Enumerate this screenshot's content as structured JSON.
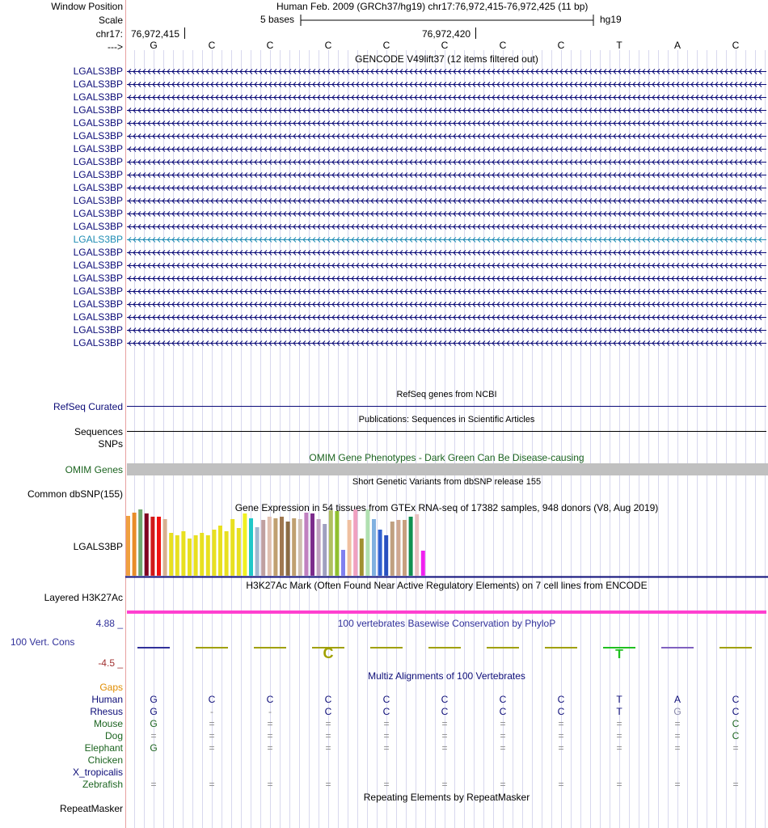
{
  "header": {
    "window_position_label": "Window Position",
    "window_position_value": "Human Feb. 2009 (GRCh37/hg19)   chr17:76,972,415-76,972,425 (11 bp)",
    "scale_label": "Scale",
    "scale_value": "5 bases",
    "assembly": "hg19",
    "chrom_label": "chr17:",
    "coord_left": "76,972,415",
    "coord_mid": "76,972,420",
    "strand_label": "--->"
  },
  "bases": [
    "G",
    "C",
    "C",
    "C",
    "C",
    "C",
    "C",
    "C",
    "T",
    "A",
    "C"
  ],
  "gencode": {
    "title": "GENCODE V49lift37 (12 items filtered out)",
    "items": [
      "LGALS3BP",
      "LGALS3BP",
      "LGALS3BP",
      "LGALS3BP",
      "LGALS3BP",
      "LGALS3BP",
      "LGALS3BP",
      "LGALS3BP",
      "LGALS3BP",
      "LGALS3BP",
      "LGALS3BP",
      "LGALS3BP",
      "LGALS3BP",
      "LGALS3BP",
      "LGALS3BP",
      "LGALS3BP",
      "LGALS3BP",
      "LGALS3BP",
      "LGALS3BP",
      "LGALS3BP",
      "LGALS3BP",
      "LGALS3BP"
    ],
    "highlight_index": 13,
    "color": "#0c0c78",
    "highlight_color": "#1e8cb4"
  },
  "refseq": {
    "title": "RefSeq genes from NCBI",
    "label": "RefSeq Curated"
  },
  "publications": {
    "title": "Publications: Sequences in Scientific Articles",
    "label": "Sequences",
    "label2": "SNPs"
  },
  "omim": {
    "title": "OMIM Gene Phenotypes - Dark Green Can Be Disease-causing",
    "label": "OMIM Genes",
    "bar_color": "#c0c0c0",
    "text_color": "#1c6420"
  },
  "dbsnp": {
    "title": "Short Genetic Variants from dbSNP release 155",
    "label": "Common dbSNP(155)"
  },
  "gtex": {
    "title": "Gene Expression in 54 tissues from GTEx RNA-seq of 17382 samples, 948 donors (V8, Aug 2019)",
    "label": "LGALS3BP",
    "bars": [
      {
        "level": 0.53,
        "color": "#f0a040"
      },
      {
        "level": 0.56,
        "color": "#e88c28"
      },
      {
        "level": 0.61,
        "color": "#70a870"
      },
      {
        "level": 0.55,
        "color": "#800020"
      },
      {
        "level": 0.52,
        "color": "#d01818"
      },
      {
        "level": 0.52,
        "color": "#f01010"
      },
      {
        "level": 0.5,
        "color": "#d8b090"
      },
      {
        "level": 0.38,
        "color": "#e8e020"
      },
      {
        "level": 0.36,
        "color": "#e8e020"
      },
      {
        "level": 0.39,
        "color": "#e8e020"
      },
      {
        "level": 0.33,
        "color": "#e8e020"
      },
      {
        "level": 0.36,
        "color": "#e8e020"
      },
      {
        "level": 0.38,
        "color": "#e8e020"
      },
      {
        "level": 0.36,
        "color": "#e8e020"
      },
      {
        "level": 0.41,
        "color": "#e8e020"
      },
      {
        "level": 0.44,
        "color": "#e8e020"
      },
      {
        "level": 0.39,
        "color": "#e8e020"
      },
      {
        "level": 0.5,
        "color": "#e8e020"
      },
      {
        "level": 0.42,
        "color": "#e8e020"
      },
      {
        "level": 0.55,
        "color": "#f0f020"
      },
      {
        "level": 0.51,
        "color": "#20c8c8"
      },
      {
        "level": 0.43,
        "color": "#a0b8d0"
      },
      {
        "level": 0.49,
        "color": "#c0a0a0"
      },
      {
        "level": 0.52,
        "color": "#e0c0b0"
      },
      {
        "level": 0.51,
        "color": "#c0a070"
      },
      {
        "level": 0.52,
        "color": "#a07850"
      },
      {
        "level": 0.48,
        "color": "#8c6c44"
      },
      {
        "level": 0.51,
        "color": "#c0a070"
      },
      {
        "level": 0.5,
        "color": "#d0c0b0"
      },
      {
        "level": 0.56,
        "color": "#c080c0"
      },
      {
        "level": 0.55,
        "color": "#7c2c8c"
      },
      {
        "level": 0.5,
        "color": "#c0a0c0"
      },
      {
        "level": 0.46,
        "color": "#a0a0c0"
      },
      {
        "level": 0.58,
        "color": "#b0c060"
      },
      {
        "level": 0.57,
        "color": "#90c030"
      },
      {
        "level": 0.23,
        "color": "#8080f0"
      },
      {
        "level": 0.49,
        "color": "#f0c0a0"
      },
      {
        "level": 0.6,
        "color": "#f0a0c0"
      },
      {
        "level": 0.33,
        "color": "#a09030"
      },
      {
        "level": 0.59,
        "color": "#b0e0b0"
      },
      {
        "level": 0.5,
        "color": "#80b0e0"
      },
      {
        "level": 0.41,
        "color": "#3060d0"
      },
      {
        "level": 0.36,
        "color": "#2850c0"
      },
      {
        "level": 0.48,
        "color": "#c0a080"
      },
      {
        "level": 0.49,
        "color": "#d0a890"
      },
      {
        "level": 0.49,
        "color": "#c8a080"
      },
      {
        "level": 0.52,
        "color": "#109050"
      },
      {
        "level": 0.54,
        "color": "#e8c0c0"
      },
      {
        "level": 0.22,
        "color": "#f020f0"
      }
    ]
  },
  "h3k27ac": {
    "title": "H3K27Ac Mark (Often Found Near Active Regulatory Elements) on 7 cell lines from ENCODE",
    "label": "Layered H3K27Ac",
    "color": "#ff40d0"
  },
  "conservation": {
    "title": "100 vertebrates Basewise Conservation by PhyloP",
    "label": "100 Vert. Cons",
    "max_label": "4.88 _",
    "min_label": "-4.5 _",
    "color": "#30309a",
    "min_color": "#a03030"
  },
  "multiz": {
    "title": "Multiz Alignments of 100 Vertebrates",
    "gaps_label": "Gaps",
    "species": [
      {
        "name": "Human",
        "color": "#0c0c78",
        "bases": [
          "G",
          "C",
          "C",
          "C",
          "C",
          "C",
          "C",
          "C",
          "T",
          "A",
          "C"
        ]
      },
      {
        "name": "Rhesus",
        "color": "#0c0c78",
        "bases": [
          "G",
          "-",
          "-",
          "C",
          "C",
          "C",
          "C",
          "C",
          "T",
          "G",
          "C"
        ]
      },
      {
        "name": "Mouse",
        "color": "#1c6420",
        "bases": [
          "G",
          "=",
          "=",
          "=",
          "=",
          "=",
          "=",
          "=",
          "=",
          "=",
          "C"
        ]
      },
      {
        "name": "Dog",
        "color": "#1c6420",
        "bases": [
          "=",
          "=",
          "=",
          "=",
          "=",
          "=",
          "=",
          "=",
          "=",
          "=",
          "C"
        ]
      },
      {
        "name": "Elephant",
        "color": "#1c6420",
        "bases": [
          "G",
          "=",
          "=",
          "=",
          "=",
          "=",
          "=",
          "=",
          "=",
          "=",
          "="
        ]
      },
      {
        "name": "Chicken",
        "color": "#1c6420",
        "bases": [
          "",
          "",
          "",
          "",
          "",
          "",
          "",
          "",
          "",
          "",
          ""
        ]
      },
      {
        "name": "X_tropicalis",
        "color": "#0c0c78",
        "bases": [
          "",
          "",
          "",
          "",
          "",
          "",
          "",
          "",
          "",
          "",
          ""
        ]
      },
      {
        "name": "Zebrafish",
        "color": "#1c6420",
        "bases": [
          "=",
          "=",
          "=",
          "=",
          "=",
          "=",
          "=",
          "=",
          "=",
          "=",
          "="
        ]
      }
    ]
  },
  "repeatmasker": {
    "title": "Repeating Elements by RepeatMasker",
    "label": "RepeatMasker"
  }
}
